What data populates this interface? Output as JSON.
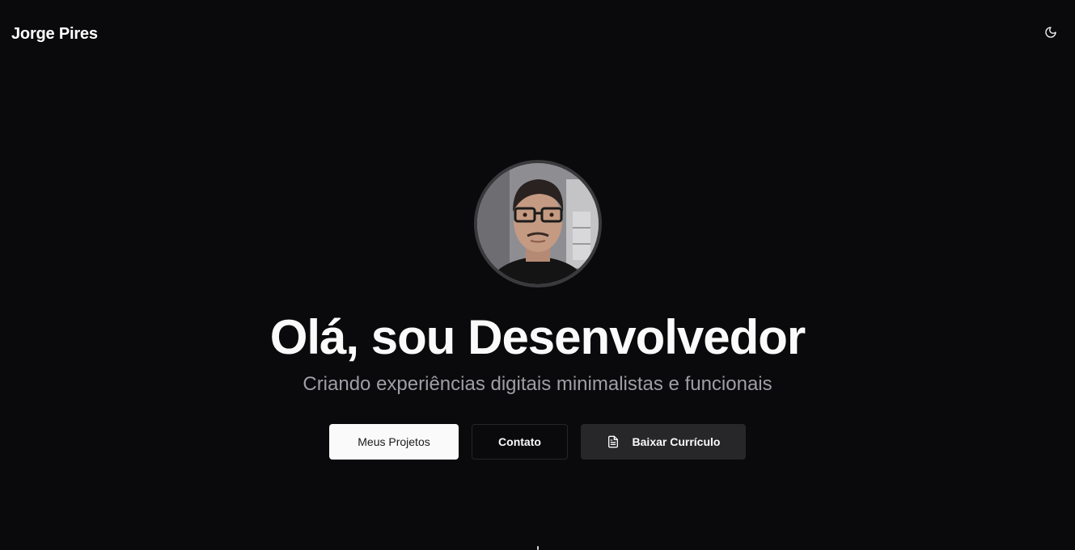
{
  "header": {
    "brand": "Jorge Pires",
    "theme_toggle_icon": "moon-icon"
  },
  "hero": {
    "avatar_alt": "profile photo",
    "headline": "Olá, sou Desenvolvedor",
    "subtitle": "Criando experiências digitais minimalistas e funcionais"
  },
  "actions": {
    "projects_label": "Meus Projetos",
    "contact_label": "Contato",
    "resume_label": "Baixar Currículo",
    "resume_icon": "file-text-icon"
  },
  "colors": {
    "background": "#0a0a0c",
    "primary_button": "#fafafa",
    "secondary_button": "#27272a",
    "subtitle_text": "#9e9ea6"
  }
}
